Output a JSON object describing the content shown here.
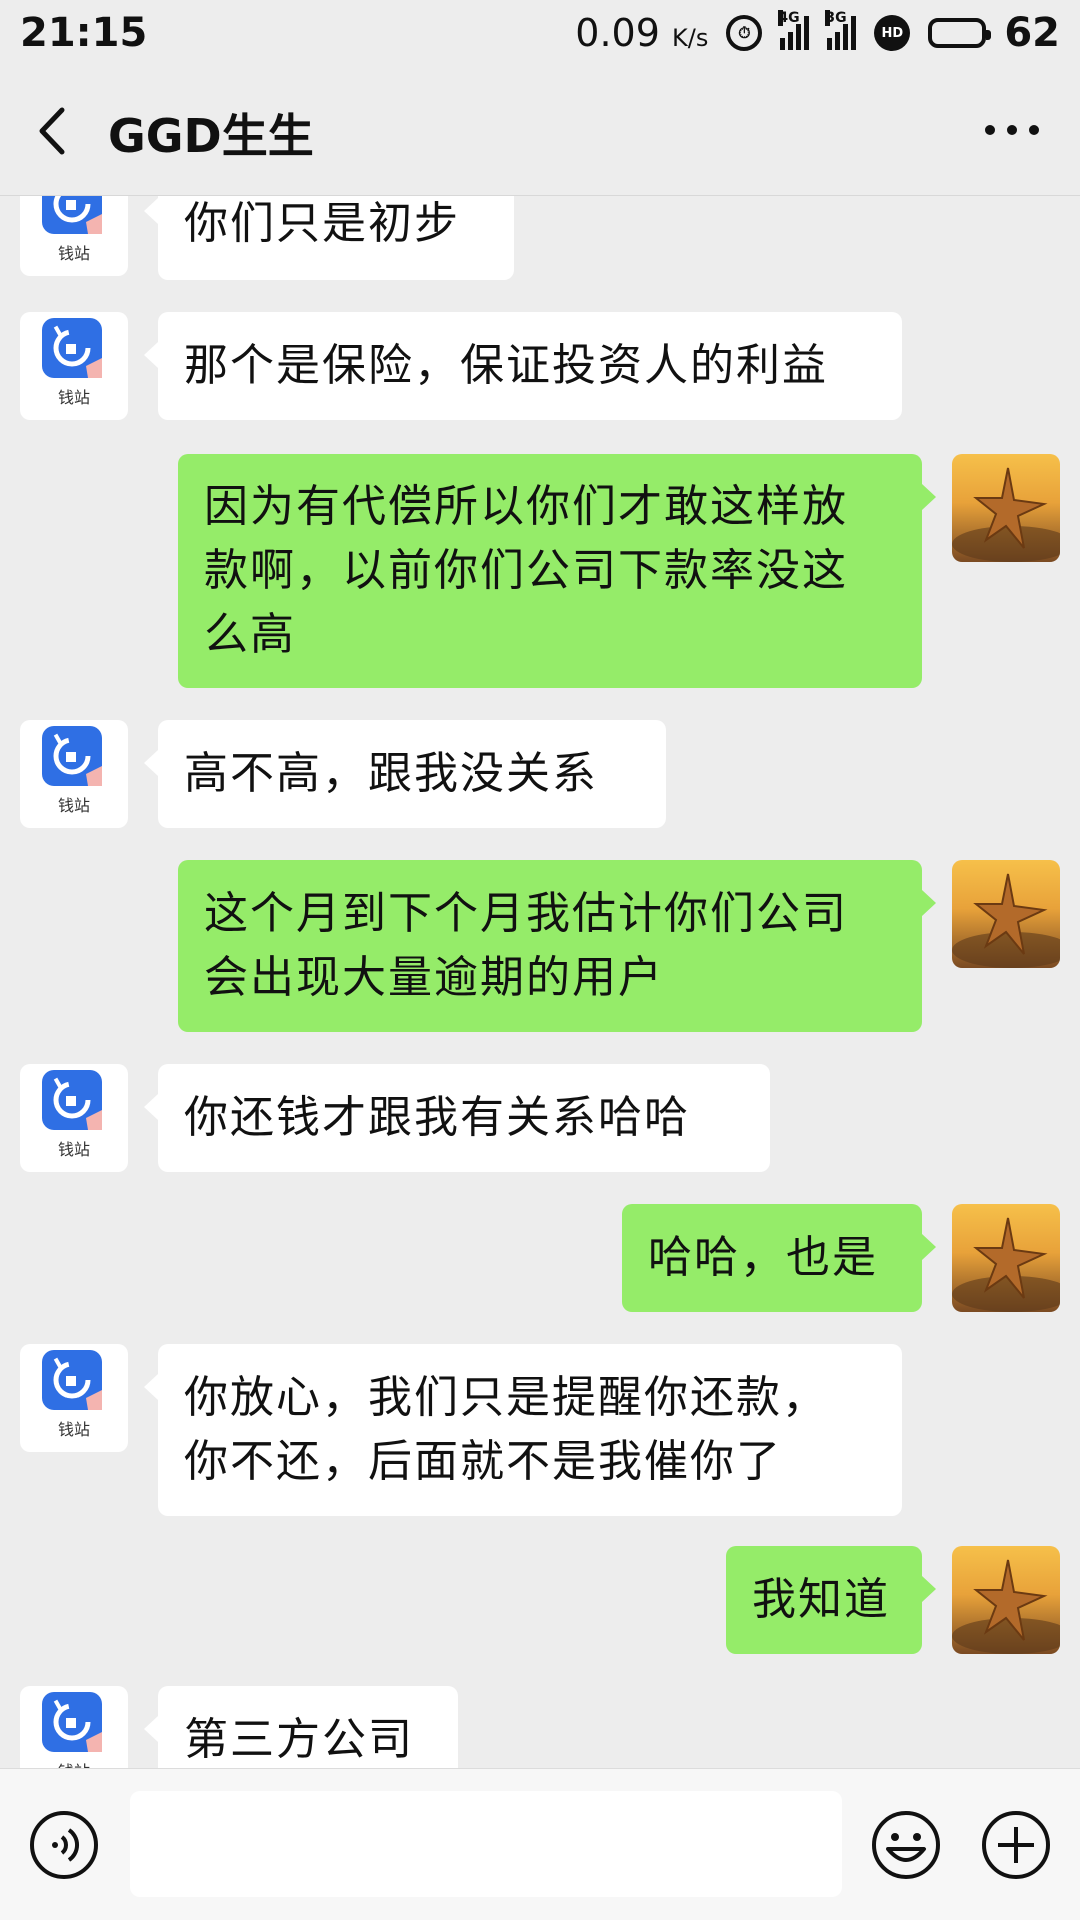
{
  "status_bar": {
    "time": "21:15",
    "speed": "0.09",
    "speed_unit": "K/s",
    "network_1": "4G",
    "network_2": "3G",
    "battery": "62"
  },
  "header": {
    "title": "GGD生生"
  },
  "contact": {
    "avatar_caption": "钱站",
    "brand_color": "#2f6fe4"
  },
  "messages": [
    {
      "side": "in",
      "text": "你们只是初步"
    },
    {
      "side": "in",
      "text": "那个是保险，保证投资人的利益"
    },
    {
      "side": "out",
      "lines": [
        "因为有代偿所以你们才敢这样放",
        "款啊，以前你们公司下款率没这",
        "么高"
      ]
    },
    {
      "side": "in",
      "text": "高不高，跟我没关系"
    },
    {
      "side": "out",
      "lines": [
        "这个月到下个月我估计你们公司",
        "会出现大量逾期的用户"
      ]
    },
    {
      "side": "in",
      "text": "你还钱才跟我有关系哈哈"
    },
    {
      "side": "out",
      "text": "哈哈，也是"
    },
    {
      "side": "in",
      "lines": [
        "你放心，我们只是提醒你还款，",
        "你不还，后面就不是我催你了"
      ]
    },
    {
      "side": "out",
      "text": "我知道"
    },
    {
      "side": "in",
      "text": "第三方公司"
    }
  ],
  "input": {
    "value": ""
  },
  "colors": {
    "background": "#ededed",
    "outgoing_bubble": "#95ec69",
    "incoming_bubble": "#ffffff"
  }
}
